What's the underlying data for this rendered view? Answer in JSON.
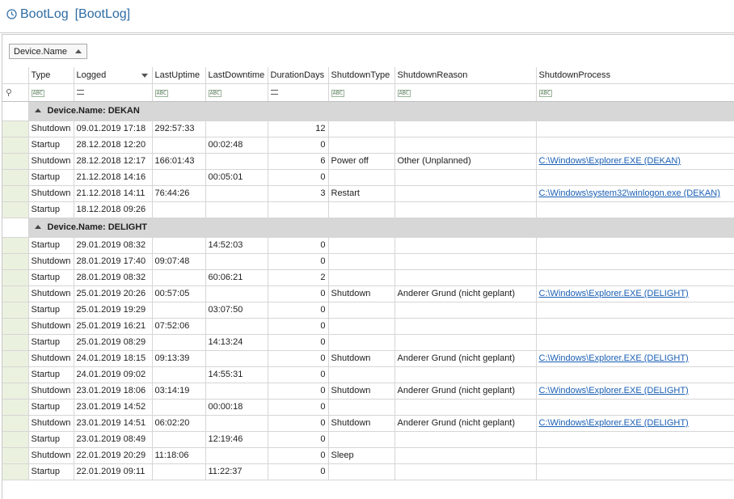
{
  "window": {
    "title": "BootLog",
    "subtitle": "[BootLog]",
    "icon": "clock-history-icon"
  },
  "group_panel": {
    "chip_label": "Device.Name",
    "chip_icon": "sort-ascending-icon"
  },
  "columns": [
    "Type",
    "Logged",
    "LastUptime",
    "LastDowntime",
    "DurationDays",
    "ShutdownType",
    "ShutdownReason",
    "ShutdownProcess"
  ],
  "filter_row": [
    "abc",
    "eq",
    "abc",
    "abc",
    "eq",
    "abc",
    "abc",
    "abc"
  ],
  "groups": [
    {
      "label": "Device.Name: DEKAN",
      "rows": [
        {
          "type": "Shutdown",
          "logged": "09.01.2019 17:18",
          "last_uptime": "292:57:33",
          "last_downtime": "",
          "duration_days": "12",
          "shutdown_type": "",
          "shutdown_reason": "",
          "shutdown_process": ""
        },
        {
          "type": "Startup",
          "logged": "28.12.2018 12:20",
          "last_uptime": "",
          "last_downtime": "00:02:48",
          "duration_days": "0",
          "shutdown_type": "",
          "shutdown_reason": "",
          "shutdown_process": ""
        },
        {
          "type": "Shutdown",
          "logged": "28.12.2018 12:17",
          "last_uptime": "166:01:43",
          "last_downtime": "",
          "duration_days": "6",
          "shutdown_type": "Power off",
          "shutdown_reason": "Other (Unplanned)",
          "shutdown_process": "C:\\Windows\\Explorer.EXE (DEKAN)"
        },
        {
          "type": "Startup",
          "logged": "21.12.2018 14:16",
          "last_uptime": "",
          "last_downtime": "00:05:01",
          "duration_days": "0",
          "shutdown_type": "",
          "shutdown_reason": "",
          "shutdown_process": ""
        },
        {
          "type": "Shutdown",
          "logged": "21.12.2018 14:11",
          "last_uptime": "76:44:26",
          "last_downtime": "",
          "duration_days": "3",
          "shutdown_type": "Restart",
          "shutdown_reason": "",
          "shutdown_process": "C:\\Windows\\system32\\winlogon.exe (DEKAN)"
        },
        {
          "type": "Startup",
          "logged": "18.12.2018 09:26",
          "last_uptime": "",
          "last_downtime": "",
          "duration_days": "",
          "shutdown_type": "",
          "shutdown_reason": "",
          "shutdown_process": ""
        }
      ]
    },
    {
      "label": "Device.Name: DELIGHT",
      "rows": [
        {
          "type": "Startup",
          "logged": "29.01.2019 08:32",
          "last_uptime": "",
          "last_downtime": "14:52:03",
          "duration_days": "0",
          "shutdown_type": "",
          "shutdown_reason": "",
          "shutdown_process": ""
        },
        {
          "type": "Shutdown",
          "logged": "28.01.2019 17:40",
          "last_uptime": "09:07:48",
          "last_downtime": "",
          "duration_days": "0",
          "shutdown_type": "",
          "shutdown_reason": "",
          "shutdown_process": ""
        },
        {
          "type": "Startup",
          "logged": "28.01.2019 08:32",
          "last_uptime": "",
          "last_downtime": "60:06:21",
          "duration_days": "2",
          "shutdown_type": "",
          "shutdown_reason": "",
          "shutdown_process": ""
        },
        {
          "type": "Shutdown",
          "logged": "25.01.2019 20:26",
          "last_uptime": "00:57:05",
          "last_downtime": "",
          "duration_days": "0",
          "shutdown_type": "Shutdown",
          "shutdown_reason": "Anderer Grund (nicht geplant)",
          "shutdown_process": "C:\\Windows\\Explorer.EXE (DELIGHT)"
        },
        {
          "type": "Startup",
          "logged": "25.01.2019 19:29",
          "last_uptime": "",
          "last_downtime": "03:07:50",
          "duration_days": "0",
          "shutdown_type": "",
          "shutdown_reason": "",
          "shutdown_process": ""
        },
        {
          "type": "Shutdown",
          "logged": "25.01.2019 16:21",
          "last_uptime": "07:52:06",
          "last_downtime": "",
          "duration_days": "0",
          "shutdown_type": "",
          "shutdown_reason": "",
          "shutdown_process": ""
        },
        {
          "type": "Startup",
          "logged": "25.01.2019 08:29",
          "last_uptime": "",
          "last_downtime": "14:13:24",
          "duration_days": "0",
          "shutdown_type": "",
          "shutdown_reason": "",
          "shutdown_process": ""
        },
        {
          "type": "Shutdown",
          "logged": "24.01.2019 18:15",
          "last_uptime": "09:13:39",
          "last_downtime": "",
          "duration_days": "0",
          "shutdown_type": "Shutdown",
          "shutdown_reason": "Anderer Grund (nicht geplant)",
          "shutdown_process": "C:\\Windows\\Explorer.EXE (DELIGHT)"
        },
        {
          "type": "Startup",
          "logged": "24.01.2019 09:02",
          "last_uptime": "",
          "last_downtime": "14:55:31",
          "duration_days": "0",
          "shutdown_type": "",
          "shutdown_reason": "",
          "shutdown_process": ""
        },
        {
          "type": "Shutdown",
          "logged": "23.01.2019 18:06",
          "last_uptime": "03:14:19",
          "last_downtime": "",
          "duration_days": "0",
          "shutdown_type": "Shutdown",
          "shutdown_reason": "Anderer Grund (nicht geplant)",
          "shutdown_process": "C:\\Windows\\Explorer.EXE (DELIGHT)"
        },
        {
          "type": "Startup",
          "logged": "23.01.2019 14:52",
          "last_uptime": "",
          "last_downtime": "00:00:18",
          "duration_days": "0",
          "shutdown_type": "",
          "shutdown_reason": "",
          "shutdown_process": ""
        },
        {
          "type": "Shutdown",
          "logged": "23.01.2019 14:51",
          "last_uptime": "06:02:20",
          "last_downtime": "",
          "duration_days": "0",
          "shutdown_type": "Shutdown",
          "shutdown_reason": "Anderer Grund (nicht geplant)",
          "shutdown_process": "C:\\Windows\\Explorer.EXE (DELIGHT)"
        },
        {
          "type": "Startup",
          "logged": "23.01.2019 08:49",
          "last_uptime": "",
          "last_downtime": "12:19:46",
          "duration_days": "0",
          "shutdown_type": "",
          "shutdown_reason": "",
          "shutdown_process": ""
        },
        {
          "type": "Shutdown",
          "logged": "22.01.2019 20:29",
          "last_uptime": "11:18:06",
          "last_downtime": "",
          "duration_days": "0",
          "shutdown_type": "Sleep",
          "shutdown_reason": "",
          "shutdown_process": ""
        },
        {
          "type": "Startup",
          "logged": "22.01.2019 09:11",
          "last_uptime": "",
          "last_downtime": "11:22:37",
          "duration_days": "0",
          "shutdown_type": "",
          "shutdown_reason": "",
          "shutdown_process": ""
        }
      ]
    }
  ]
}
